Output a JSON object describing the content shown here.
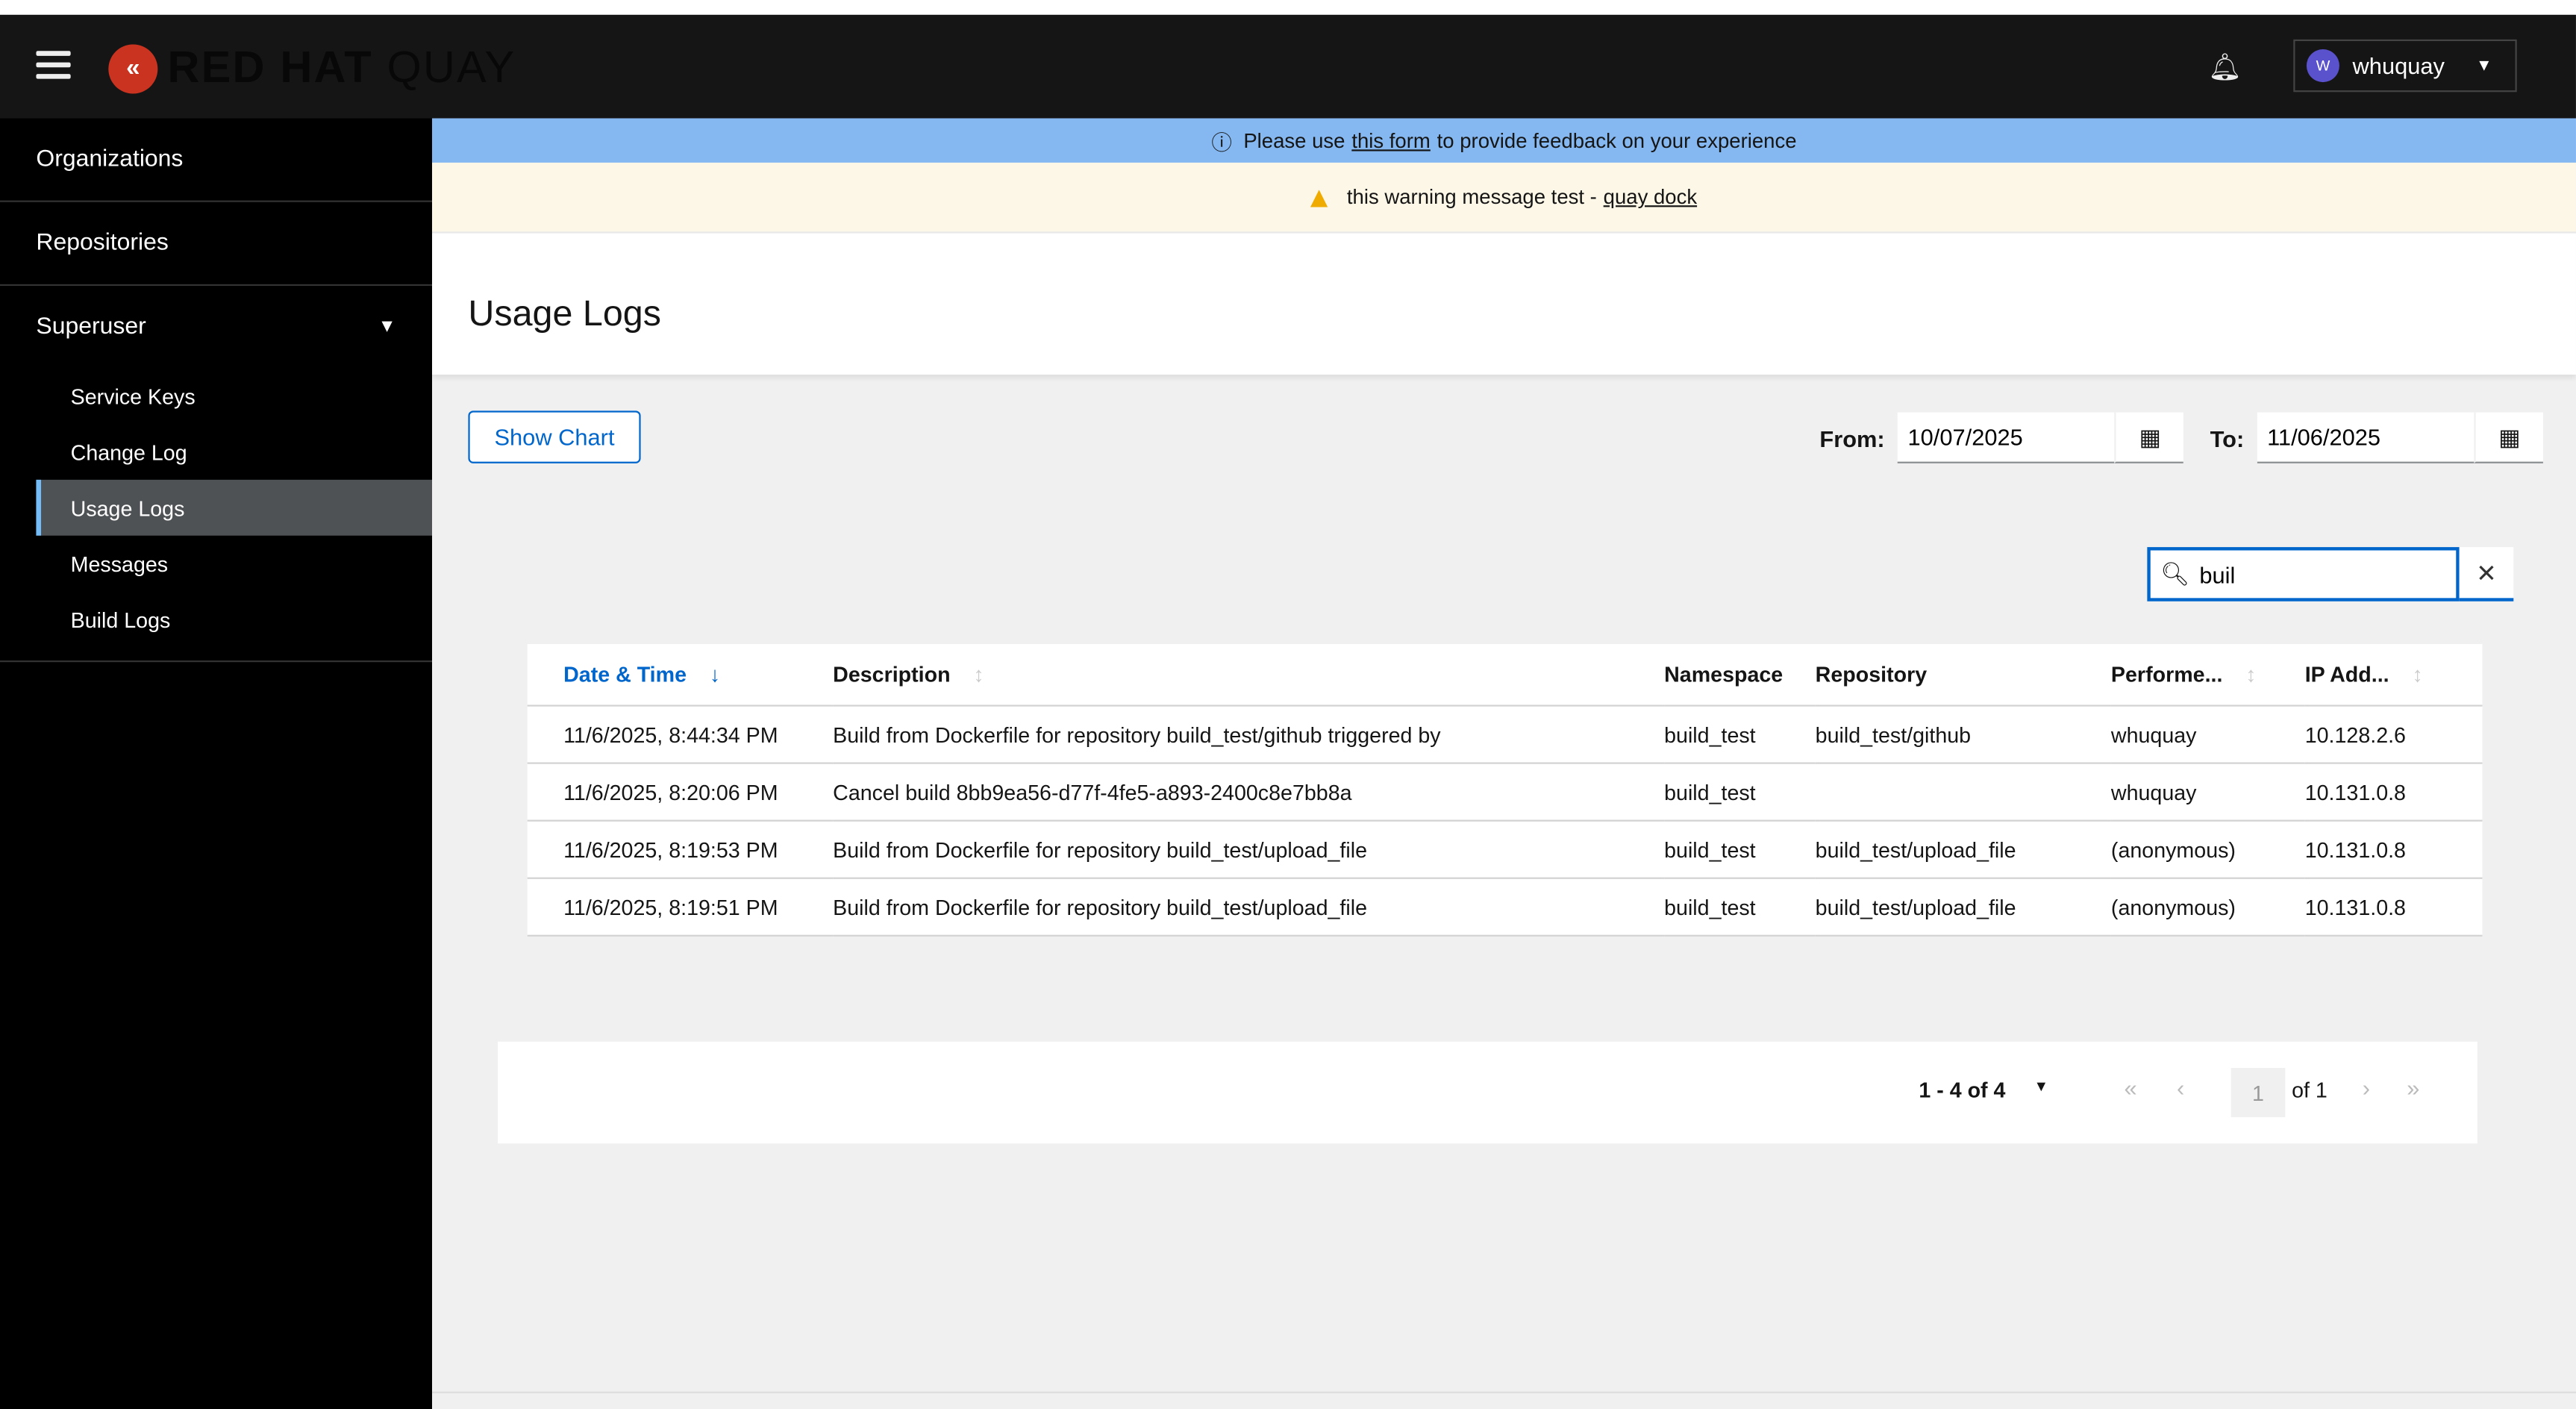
{
  "header": {
    "brand_bold": "RED HAT",
    "brand_light": "QUAY",
    "user": "whuquay",
    "avatar_initial": "W"
  },
  "sidebar": {
    "items": [
      {
        "label": "Organizations"
      },
      {
        "label": "Repositories"
      }
    ],
    "group": {
      "label": "Superuser",
      "children": [
        {
          "label": "Service Keys"
        },
        {
          "label": "Change Log"
        },
        {
          "label": "Usage Logs",
          "active": true
        },
        {
          "label": "Messages"
        },
        {
          "label": "Build Logs"
        }
      ]
    }
  },
  "banners": {
    "info_prefix": "Please use",
    "info_link": "this form",
    "info_suffix": "to provide feedback on your experience",
    "warn_text": "this warning message test -",
    "warn_link": "quay dock"
  },
  "page": {
    "title": "Usage Logs",
    "show_chart": "Show Chart",
    "from_label": "From:",
    "from_value": "10/07/2025",
    "to_label": "To:",
    "to_value": "11/06/2025",
    "search_value": "buil"
  },
  "table": {
    "headers": [
      "Date & Time",
      "Description",
      "Namespace",
      "Repository",
      "Performe...",
      "IP Add..."
    ],
    "rows": [
      [
        "11/6/2025, 8:44:34 PM",
        "Build from Dockerfile for repository build_test/github triggered by",
        "build_test",
        "build_test/github",
        "whuquay",
        "10.128.2.6"
      ],
      [
        "11/6/2025, 8:20:06 PM",
        "Cancel build 8bb9ea56-d77f-4fe5-a893-2400c8e7bb8a",
        "build_test",
        "",
        "whuquay",
        "10.131.0.8"
      ],
      [
        "11/6/2025, 8:19:53 PM",
        "Build from Dockerfile for repository build_test/upload_file",
        "build_test",
        "build_test/upload_file",
        "(anonymous)",
        "10.131.0.8"
      ],
      [
        "11/6/2025, 8:19:51 PM",
        "Build from Dockerfile for repository build_test/upload_file",
        "build_test",
        "build_test/upload_file",
        "(anonymous)",
        "10.131.0.8"
      ]
    ]
  },
  "pagination": {
    "range": "1 - 4 of 4",
    "page": "1",
    "of": "of 1"
  },
  "colors": {
    "accent": "#0066cc",
    "info_banner": "#85b8f1",
    "warning": "#f0ab00",
    "brand_red": "#c9331f"
  }
}
